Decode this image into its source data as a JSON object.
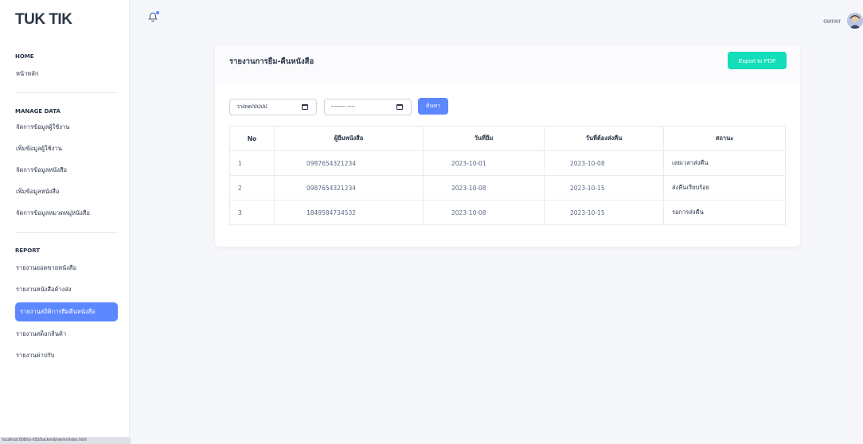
{
  "brand": "TUK TIK",
  "sidebar": {
    "sections": [
      {
        "title": "HOME",
        "items": [
          "หน้าหลัก"
        ]
      },
      {
        "title": "MANAGE DATA",
        "items": [
          "จัดการข้อมูลผู้ใช้งาน",
          "เพิ่มข้อมูลผู้ใช้งาน",
          "จัดการข้อมูลหนังสือ",
          "เพิ่มข้อมูลหนังสือ",
          "จัดการข้อมูลหมวดหมู่หนังสือ"
        ]
      },
      {
        "title": "REPORT",
        "items": [
          "รายงานยอดขายหนังสือ",
          "รายงานหนังสือค้างส่ง",
          "รายงานสถิติการยืมคืนหนังสือ",
          "รายงานสต็อกสินค้า",
          "รายงานค่าปรับ"
        ]
      }
    ],
    "active_item": "รายงานสถิติการยืมคืนหนังสือ"
  },
  "status_url": "localhost:8080/s-655/backend/owner/index.html",
  "topbar": {
    "user": "owner"
  },
  "report": {
    "title": "รายงานการยืม-คืนหนังสือ",
    "export_label": "Export to PDF",
    "start_date_placeholder": "วว/ดด/ปปปป",
    "end_date_placeholder": "-------- ----",
    "search_label": "ค้นหา",
    "columns": [
      "No",
      "ผู้ยืมหนังสือ",
      "วันที่ยืม",
      "วันที่ต้องส่งคืน",
      "สถานะ"
    ],
    "rows": [
      [
        "1",
        "0987654321234",
        "2023-10-01",
        "2023-10-08",
        "เลยเวลาส่งคืน"
      ],
      [
        "2",
        "0987654321234",
        "2023-10-08",
        "2023-10-15",
        "ส่งคืนเรียบร้อย"
      ],
      [
        "3",
        "1849584734532",
        "2023-10-08",
        "2023-10-15",
        "รอการส่งคืน"
      ]
    ]
  }
}
